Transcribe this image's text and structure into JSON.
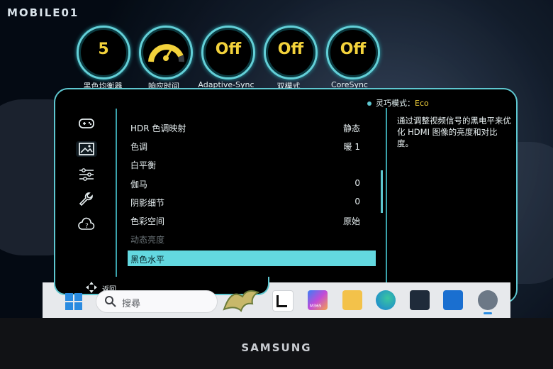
{
  "watermark": "MOBILE01",
  "gauges": [
    {
      "value": "5",
      "label": "黑色均衡器"
    },
    {
      "value": "",
      "label": "响应时间"
    },
    {
      "value": "Off",
      "label": "Adaptive-Sync"
    },
    {
      "value": "Off",
      "label": "双模式"
    },
    {
      "value": "Off",
      "label": "CoreSync"
    }
  ],
  "mode": {
    "label": "灵巧模式：",
    "value": "Eco"
  },
  "menu": [
    {
      "label": "HDR 色调映射",
      "value": "静态"
    },
    {
      "label": "色调",
      "value": "暖 1"
    },
    {
      "label": "白平衡",
      "value": ""
    },
    {
      "label": "伽马",
      "value": "0"
    },
    {
      "label": "阴影细节",
      "value": "0"
    },
    {
      "label": "色彩空间",
      "value": "原始"
    },
    {
      "label": "动态亮度",
      "value": ""
    },
    {
      "label": "黑色水平",
      "value": ""
    }
  ],
  "description": "通过调整视频信号的黑电平来优化 HDMI 图像的亮度和对比度。",
  "back_label": "返回",
  "taskbar": {
    "search_placeholder": "搜尋",
    "copilot_badge": "M365"
  },
  "brand": "SAMSUNG",
  "colors": {
    "accent": "#5ec7d0",
    "value_yellow": "#f3d23b",
    "selected": "#63d8e0"
  }
}
